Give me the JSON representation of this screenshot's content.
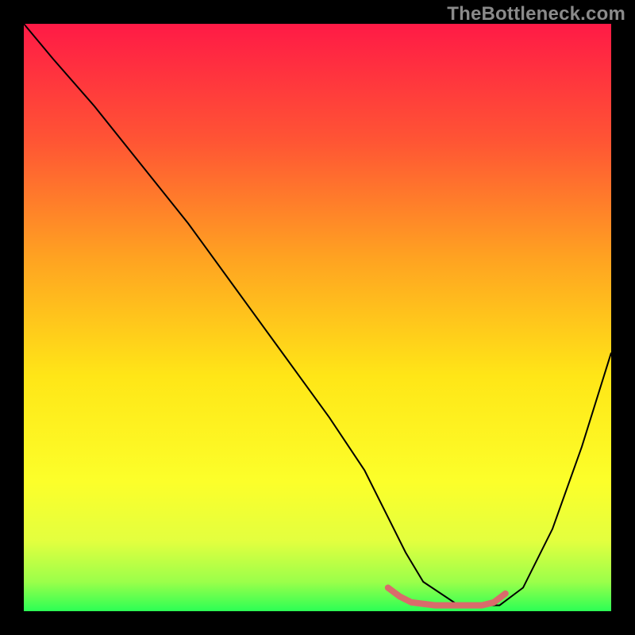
{
  "watermark": "TheBottleneck.com",
  "chart_data": {
    "type": "line",
    "title": "",
    "xlabel": "",
    "ylabel": "",
    "xlim": [
      0,
      100
    ],
    "ylim": [
      0,
      100
    ],
    "grid": false,
    "legend": false,
    "gradient_stops": [
      {
        "offset": 0.0,
        "color": "#ff1a46"
      },
      {
        "offset": 0.2,
        "color": "#ff5534"
      },
      {
        "offset": 0.4,
        "color": "#ffa321"
      },
      {
        "offset": 0.6,
        "color": "#ffe617"
      },
      {
        "offset": 0.78,
        "color": "#fcff2a"
      },
      {
        "offset": 0.88,
        "color": "#e3ff3f"
      },
      {
        "offset": 0.95,
        "color": "#9bff4a"
      },
      {
        "offset": 1.0,
        "color": "#2bff55"
      }
    ],
    "series": [
      {
        "name": "curve",
        "stroke": "#000000",
        "stroke_width": 2,
        "x": [
          0,
          5,
          12,
          20,
          28,
          36,
          44,
          52,
          58,
          62,
          65,
          68,
          74,
          78,
          81,
          85,
          90,
          95,
          100
        ],
        "values": [
          100,
          94,
          86,
          76,
          66,
          55,
          44,
          33,
          24,
          16,
          10,
          5,
          1,
          1,
          1,
          4,
          14,
          28,
          44
        ]
      },
      {
        "name": "optimal-band",
        "stroke": "#d96b6b",
        "stroke_width": 8,
        "linecap": "round",
        "x": [
          62,
          64,
          66,
          70,
          74,
          78,
          80,
          82
        ],
        "values": [
          4,
          2.5,
          1.5,
          1,
          1,
          1,
          1.5,
          3
        ]
      }
    ]
  }
}
